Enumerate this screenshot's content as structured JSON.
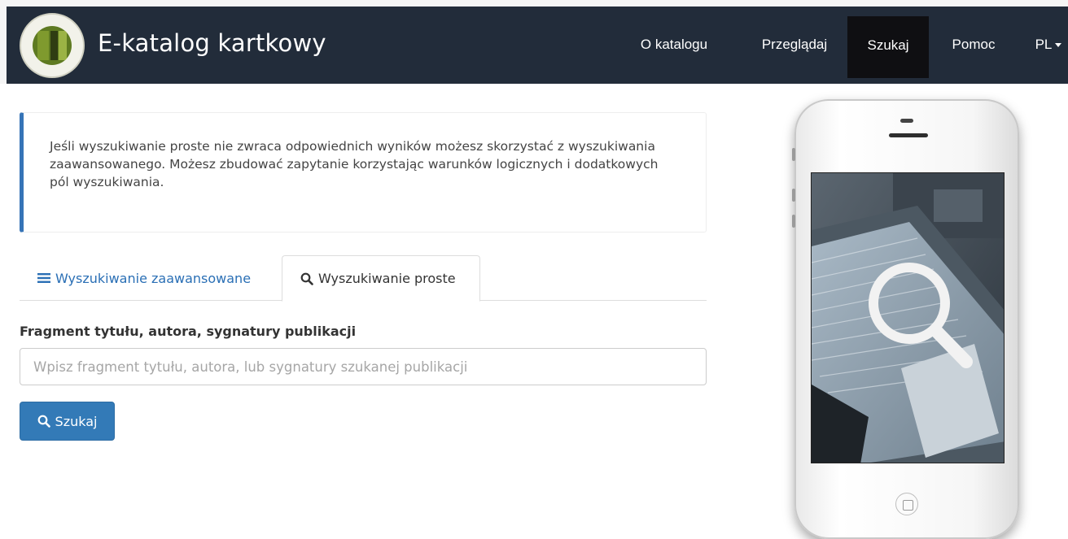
{
  "header": {
    "brand_title": "E-katalog kartkowy",
    "nav": [
      {
        "label": "O katalogu"
      },
      {
        "label": "Przeglądaj"
      },
      {
        "label": "Szukaj"
      },
      {
        "label": "Pomoc"
      },
      {
        "label": "PL"
      }
    ],
    "active_nav": "Szukaj"
  },
  "info": {
    "text": "Jeśli wyszukiwanie proste nie zwraca odpowiednich wyników możesz skorzystać z wyszukiwania zaawansowanego. Możesz zbudować zapytanie korzystając warunków logicznych i dodatkowych pól wyszukiwania."
  },
  "tabs": [
    {
      "label": "Wyszukiwanie zaawansowane",
      "icon": "list-icon",
      "active": false
    },
    {
      "label": "Wyszukiwanie proste",
      "icon": "search-icon",
      "active": true
    }
  ],
  "form": {
    "field_label": "Fragment tytułu, autora, sygnatury publikacji",
    "placeholder": "Wpisz fragment tytułu, autora, lub sygnatury szukanej publikacji",
    "value": "",
    "button_label": "Szukaj"
  },
  "colors": {
    "navbar": "#222c3a",
    "accent": "#337ab7",
    "link": "#2a6fb5",
    "active_nav": "#0f0f12"
  }
}
